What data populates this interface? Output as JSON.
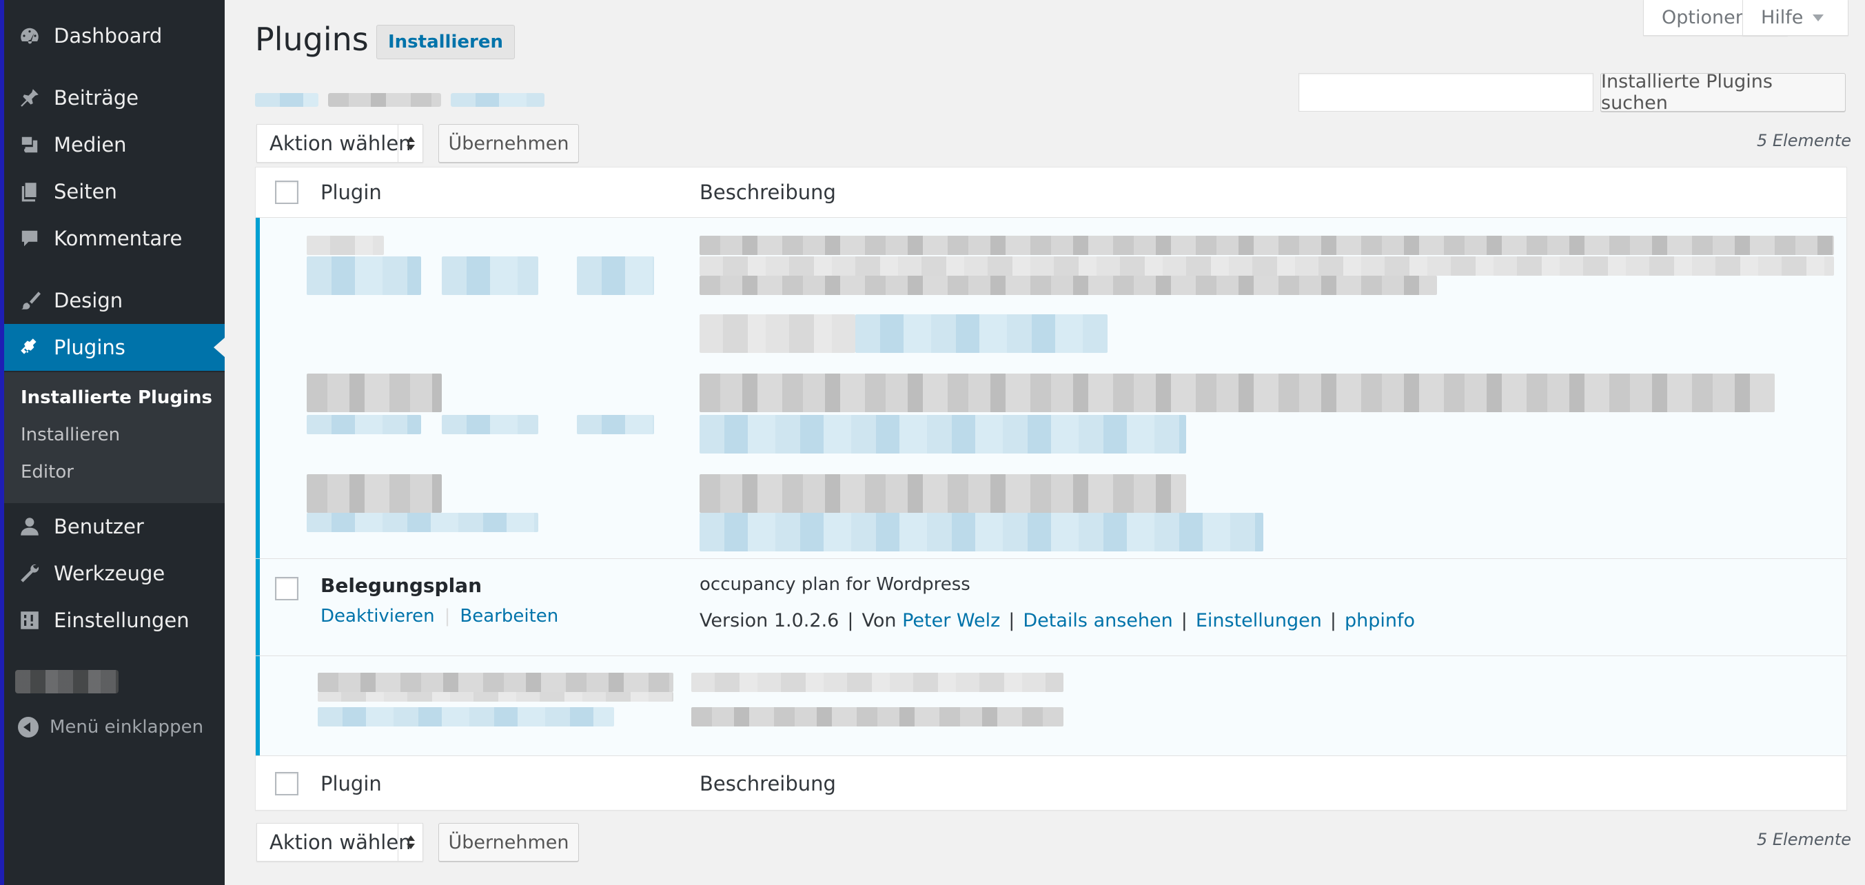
{
  "sidebar": {
    "items": [
      {
        "label": "Dashboard",
        "icon": "dashboard-icon"
      },
      {
        "label": "Beiträge",
        "icon": "pin-icon"
      },
      {
        "label": "Medien",
        "icon": "media-icon"
      },
      {
        "label": "Seiten",
        "icon": "pages-icon"
      },
      {
        "label": "Kommentare",
        "icon": "comment-icon"
      },
      {
        "label": "Design",
        "icon": "paintbrush-icon"
      },
      {
        "label": "Plugins",
        "icon": "plugin-icon"
      },
      {
        "label": "Benutzer",
        "icon": "user-icon"
      },
      {
        "label": "Werkzeuge",
        "icon": "wrench-icon"
      },
      {
        "label": "Einstellungen",
        "icon": "settings-icon"
      }
    ],
    "submenu": [
      "Installierte Plugins",
      "Installieren",
      "Editor"
    ],
    "collapse_label": "Menü einklappen"
  },
  "header": {
    "title": "Plugins",
    "add_new": "Installieren",
    "options": "Optionen",
    "help": "Hilfe"
  },
  "search": {
    "button": "Installierte Plugins suchen",
    "value": ""
  },
  "bulk": {
    "select_label": "Aktion wählen",
    "apply_label": "Übernehmen",
    "count": "5 Elemente"
  },
  "table": {
    "col_plugin": "Plugin",
    "col_desc": "Beschreibung",
    "plugin": {
      "name": "Belegungsplan",
      "deactivate": "Deaktivieren",
      "edit": "Bearbeiten",
      "description": "occupancy plan for Wordpress",
      "version": "Version 1.0.2.6",
      "by": "Von",
      "author": "Peter Welz",
      "details": "Details ansehen",
      "settings": "Einstellungen",
      "phpinfo": "phpinfo"
    }
  },
  "colors": {
    "sidebar_bg": "#23282d",
    "active_menu": "#0073aa",
    "link": "#0073aa",
    "active_plugin_border": "#00a0d2"
  }
}
